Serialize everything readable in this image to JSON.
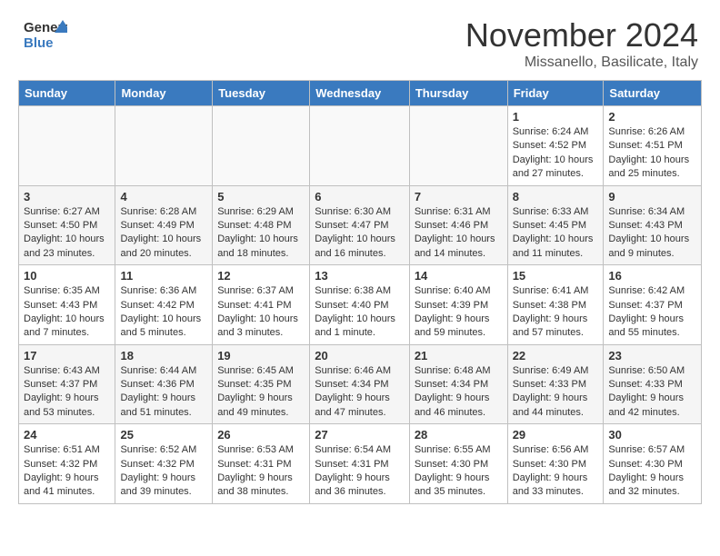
{
  "header": {
    "logo_general": "General",
    "logo_blue": "Blue",
    "month_title": "November 2024",
    "subtitle": "Missanello, Basilicate, Italy"
  },
  "columns": [
    "Sunday",
    "Monday",
    "Tuesday",
    "Wednesday",
    "Thursday",
    "Friday",
    "Saturday"
  ],
  "weeks": [
    [
      {
        "day": "",
        "info": "",
        "empty": true
      },
      {
        "day": "",
        "info": "",
        "empty": true
      },
      {
        "day": "",
        "info": "",
        "empty": true
      },
      {
        "day": "",
        "info": "",
        "empty": true
      },
      {
        "day": "",
        "info": "",
        "empty": true
      },
      {
        "day": "1",
        "info": "Sunrise: 6:24 AM\nSunset: 4:52 PM\nDaylight: 10 hours and 27 minutes."
      },
      {
        "day": "2",
        "info": "Sunrise: 6:26 AM\nSunset: 4:51 PM\nDaylight: 10 hours and 25 minutes."
      }
    ],
    [
      {
        "day": "3",
        "info": "Sunrise: 6:27 AM\nSunset: 4:50 PM\nDaylight: 10 hours and 23 minutes."
      },
      {
        "day": "4",
        "info": "Sunrise: 6:28 AM\nSunset: 4:49 PM\nDaylight: 10 hours and 20 minutes."
      },
      {
        "day": "5",
        "info": "Sunrise: 6:29 AM\nSunset: 4:48 PM\nDaylight: 10 hours and 18 minutes."
      },
      {
        "day": "6",
        "info": "Sunrise: 6:30 AM\nSunset: 4:47 PM\nDaylight: 10 hours and 16 minutes."
      },
      {
        "day": "7",
        "info": "Sunrise: 6:31 AM\nSunset: 4:46 PM\nDaylight: 10 hours and 14 minutes."
      },
      {
        "day": "8",
        "info": "Sunrise: 6:33 AM\nSunset: 4:45 PM\nDaylight: 10 hours and 11 minutes."
      },
      {
        "day": "9",
        "info": "Sunrise: 6:34 AM\nSunset: 4:43 PM\nDaylight: 10 hours and 9 minutes."
      }
    ],
    [
      {
        "day": "10",
        "info": "Sunrise: 6:35 AM\nSunset: 4:43 PM\nDaylight: 10 hours and 7 minutes."
      },
      {
        "day": "11",
        "info": "Sunrise: 6:36 AM\nSunset: 4:42 PM\nDaylight: 10 hours and 5 minutes."
      },
      {
        "day": "12",
        "info": "Sunrise: 6:37 AM\nSunset: 4:41 PM\nDaylight: 10 hours and 3 minutes."
      },
      {
        "day": "13",
        "info": "Sunrise: 6:38 AM\nSunset: 4:40 PM\nDaylight: 10 hours and 1 minute."
      },
      {
        "day": "14",
        "info": "Sunrise: 6:40 AM\nSunset: 4:39 PM\nDaylight: 9 hours and 59 minutes."
      },
      {
        "day": "15",
        "info": "Sunrise: 6:41 AM\nSunset: 4:38 PM\nDaylight: 9 hours and 57 minutes."
      },
      {
        "day": "16",
        "info": "Sunrise: 6:42 AM\nSunset: 4:37 PM\nDaylight: 9 hours and 55 minutes."
      }
    ],
    [
      {
        "day": "17",
        "info": "Sunrise: 6:43 AM\nSunset: 4:37 PM\nDaylight: 9 hours and 53 minutes."
      },
      {
        "day": "18",
        "info": "Sunrise: 6:44 AM\nSunset: 4:36 PM\nDaylight: 9 hours and 51 minutes."
      },
      {
        "day": "19",
        "info": "Sunrise: 6:45 AM\nSunset: 4:35 PM\nDaylight: 9 hours and 49 minutes."
      },
      {
        "day": "20",
        "info": "Sunrise: 6:46 AM\nSunset: 4:34 PM\nDaylight: 9 hours and 47 minutes."
      },
      {
        "day": "21",
        "info": "Sunrise: 6:48 AM\nSunset: 4:34 PM\nDaylight: 9 hours and 46 minutes."
      },
      {
        "day": "22",
        "info": "Sunrise: 6:49 AM\nSunset: 4:33 PM\nDaylight: 9 hours and 44 minutes."
      },
      {
        "day": "23",
        "info": "Sunrise: 6:50 AM\nSunset: 4:33 PM\nDaylight: 9 hours and 42 minutes."
      }
    ],
    [
      {
        "day": "24",
        "info": "Sunrise: 6:51 AM\nSunset: 4:32 PM\nDaylight: 9 hours and 41 minutes."
      },
      {
        "day": "25",
        "info": "Sunrise: 6:52 AM\nSunset: 4:32 PM\nDaylight: 9 hours and 39 minutes."
      },
      {
        "day": "26",
        "info": "Sunrise: 6:53 AM\nSunset: 4:31 PM\nDaylight: 9 hours and 38 minutes."
      },
      {
        "day": "27",
        "info": "Sunrise: 6:54 AM\nSunset: 4:31 PM\nDaylight: 9 hours and 36 minutes."
      },
      {
        "day": "28",
        "info": "Sunrise: 6:55 AM\nSunset: 4:30 PM\nDaylight: 9 hours and 35 minutes."
      },
      {
        "day": "29",
        "info": "Sunrise: 6:56 AM\nSunset: 4:30 PM\nDaylight: 9 hours and 33 minutes."
      },
      {
        "day": "30",
        "info": "Sunrise: 6:57 AM\nSunset: 4:30 PM\nDaylight: 9 hours and 32 minutes."
      }
    ]
  ]
}
